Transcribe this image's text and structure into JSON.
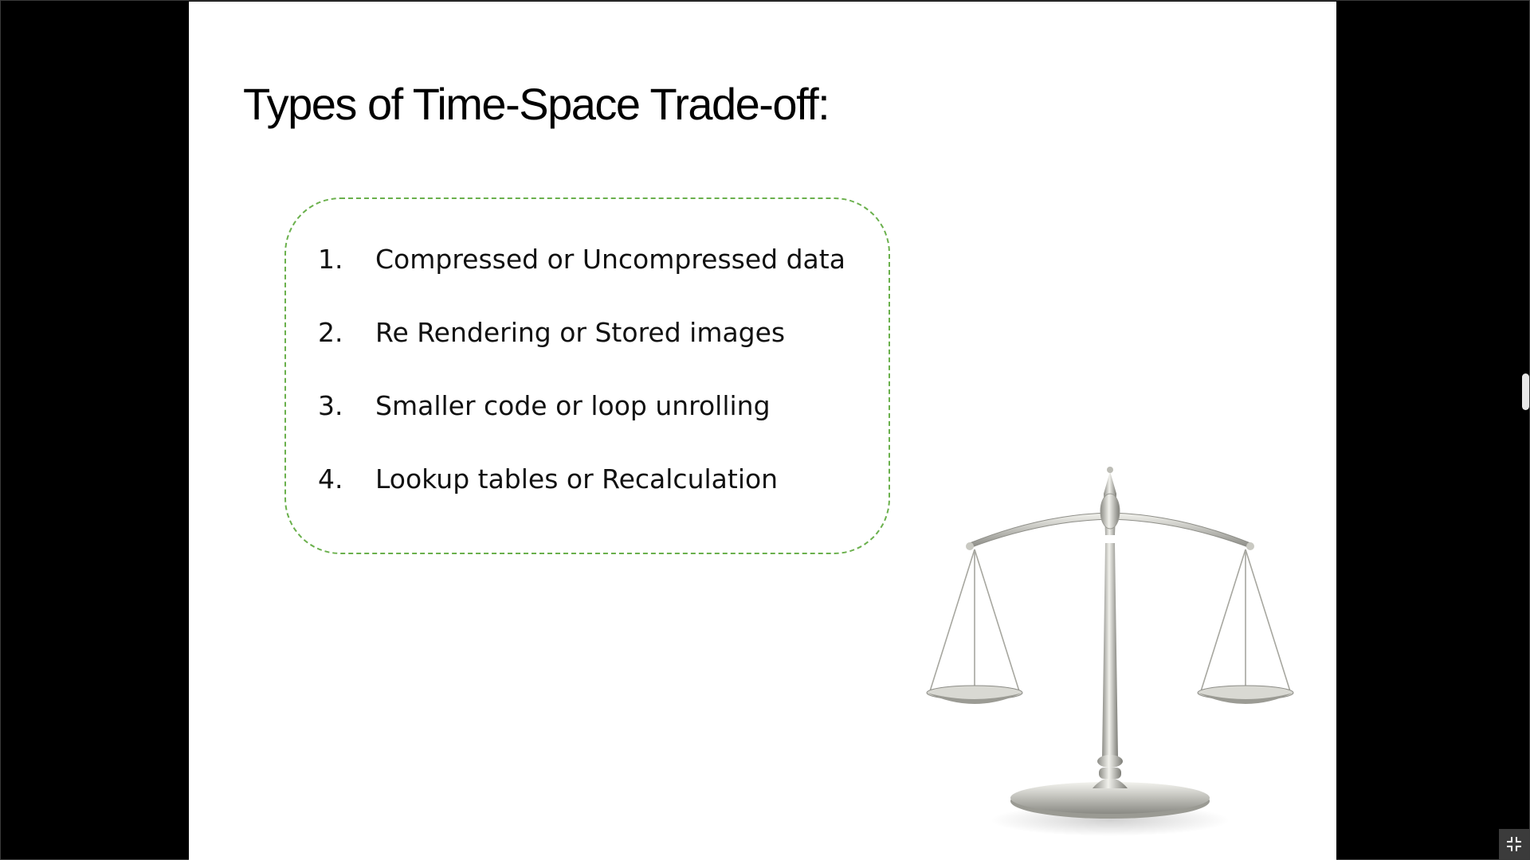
{
  "slide": {
    "title": "Types of Time-Space Trade-off:",
    "items": [
      {
        "number": "1.",
        "text": "Compressed or Uncompressed data"
      },
      {
        "number": "2.",
        "text": "Re Rendering or Stored images"
      },
      {
        "number": "3.",
        "text": "Smaller code or loop unrolling"
      },
      {
        "number": "4.",
        "text": "Lookup tables or Recalculation"
      }
    ],
    "image": "balance-scale-icon",
    "accent_color": "#6ab04c"
  },
  "controls": {
    "exit_fullscreen_icon": "exit-fullscreen-icon"
  }
}
